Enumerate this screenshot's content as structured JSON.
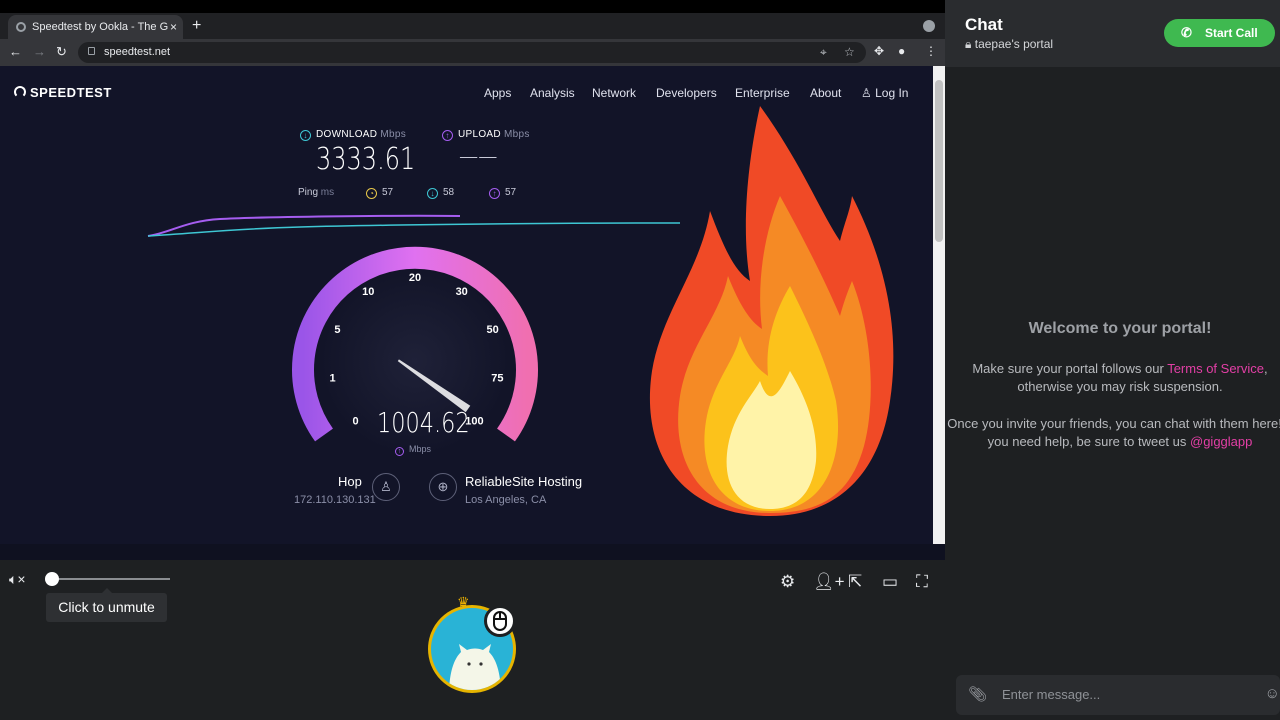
{
  "browser": {
    "tab_title": "Speedtest by Ookla - The G",
    "tab_close": "×",
    "new_tab": "+",
    "url": "speedtest.net"
  },
  "speedtest": {
    "logo": "SPEEDTEST",
    "nav": [
      "Apps",
      "Analysis",
      "Network",
      "Developers",
      "Enterprise",
      "About",
      "Log In"
    ],
    "download_label": "DOWNLOAD",
    "download_unit": "Mbps",
    "download_value": "3333.61",
    "upload_label": "UPLOAD",
    "upload_unit": "Mbps",
    "upload_value": "——",
    "ping_label": "Ping",
    "ping_unit": "ms",
    "ping_idle": "57",
    "ping_down": "58",
    "ping_up": "57",
    "gauge_ticks": [
      "0",
      "1",
      "5",
      "10",
      "20",
      "30",
      "50",
      "75",
      "100"
    ],
    "gauge_value": "1004.62",
    "gauge_unit": "Mbps",
    "gauge_fraction": 1.0,
    "isp_name": "Hop",
    "isp_ip": "172.110.130.131",
    "server_name": "ReliableSite Hosting",
    "server_location": "Los Angeles, CA",
    "colors": {
      "download": "#3ec7d4",
      "upload": "#a55df0",
      "ping": "#e8c84a"
    }
  },
  "player": {
    "tooltip": "Click to unmute",
    "volume_fraction": 0.0
  },
  "chat": {
    "title": "Chat",
    "portal_name": "taepae's portal",
    "start_call": "Start Call",
    "welcome": "Welcome to your portal!",
    "p1_pre": "Make sure your portal follows our ",
    "p1_link": "Terms of Service",
    "p1_post": ", otherwise you may risk suspension.",
    "p2_pre": "Once you invite your friends, you can chat with them here! If you need help, be sure to tweet us ",
    "p2_link": "@gigglapp",
    "input_placeholder": "Enter message...",
    "call_color": "#3fb950",
    "link_color": "#e33fa6"
  }
}
